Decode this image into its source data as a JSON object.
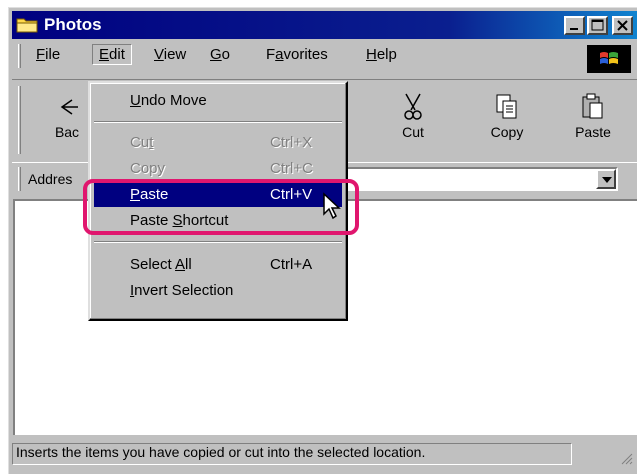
{
  "window": {
    "title": "Photos",
    "controls": {
      "minimize": "minimize",
      "maximize": "maximize",
      "close": "close"
    }
  },
  "menubar": {
    "items": [
      {
        "label": "File",
        "mnemonic": "F",
        "rest": "ile"
      },
      {
        "label": "Edit",
        "mnemonic": "E",
        "rest": "dit",
        "active": true
      },
      {
        "label": "View",
        "mnemonic": "V",
        "rest": "iew"
      },
      {
        "label": "Go",
        "mnemonic": "G",
        "rest": "o"
      },
      {
        "label": "Favorites",
        "pre": "F",
        "mnemonic": "a",
        "rest": "vorites"
      },
      {
        "label": "Help",
        "mnemonic": "H",
        "rest": "elp"
      }
    ]
  },
  "toolbar": {
    "back_label": "Bac",
    "cut_label": "Cut",
    "copy_label": "Copy",
    "paste_label": "Paste"
  },
  "addressbar": {
    "label": "Addres"
  },
  "edit_menu": {
    "undo": {
      "mnemonic": "U",
      "rest": "ndo Move"
    },
    "cut": {
      "pre": "Cu",
      "mnemonic": "t",
      "shortcut": "Ctrl+X",
      "enabled": false
    },
    "copy": {
      "label": "Copy",
      "shortcut": "Ctrl+C",
      "enabled": false
    },
    "paste": {
      "mnemonic": "P",
      "rest": "aste",
      "shortcut": "Ctrl+V",
      "selected": true
    },
    "paste_shortcut": {
      "pre": "Paste ",
      "mnemonic": "S",
      "rest": "hortcut"
    },
    "select_all": {
      "pre": "Select ",
      "mnemonic": "A",
      "rest": "ll",
      "shortcut": "Ctrl+A"
    },
    "invert": {
      "mnemonic": "I",
      "rest": "nvert Selection"
    }
  },
  "statusbar": {
    "text": "Inserts the items you have copied or cut into the selected location."
  },
  "colors": {
    "titlebar": "#000080",
    "menu_selection": "#000080",
    "highlight_ring": "#e0166e",
    "face": "#c0c0c0"
  },
  "icons": [
    "folder-icon",
    "windows-flag-icon",
    "back-arrow-icon",
    "scissors-icon",
    "copy-icon",
    "paste-icon",
    "pointer-cursor-icon",
    "resize-grip-icon"
  ]
}
